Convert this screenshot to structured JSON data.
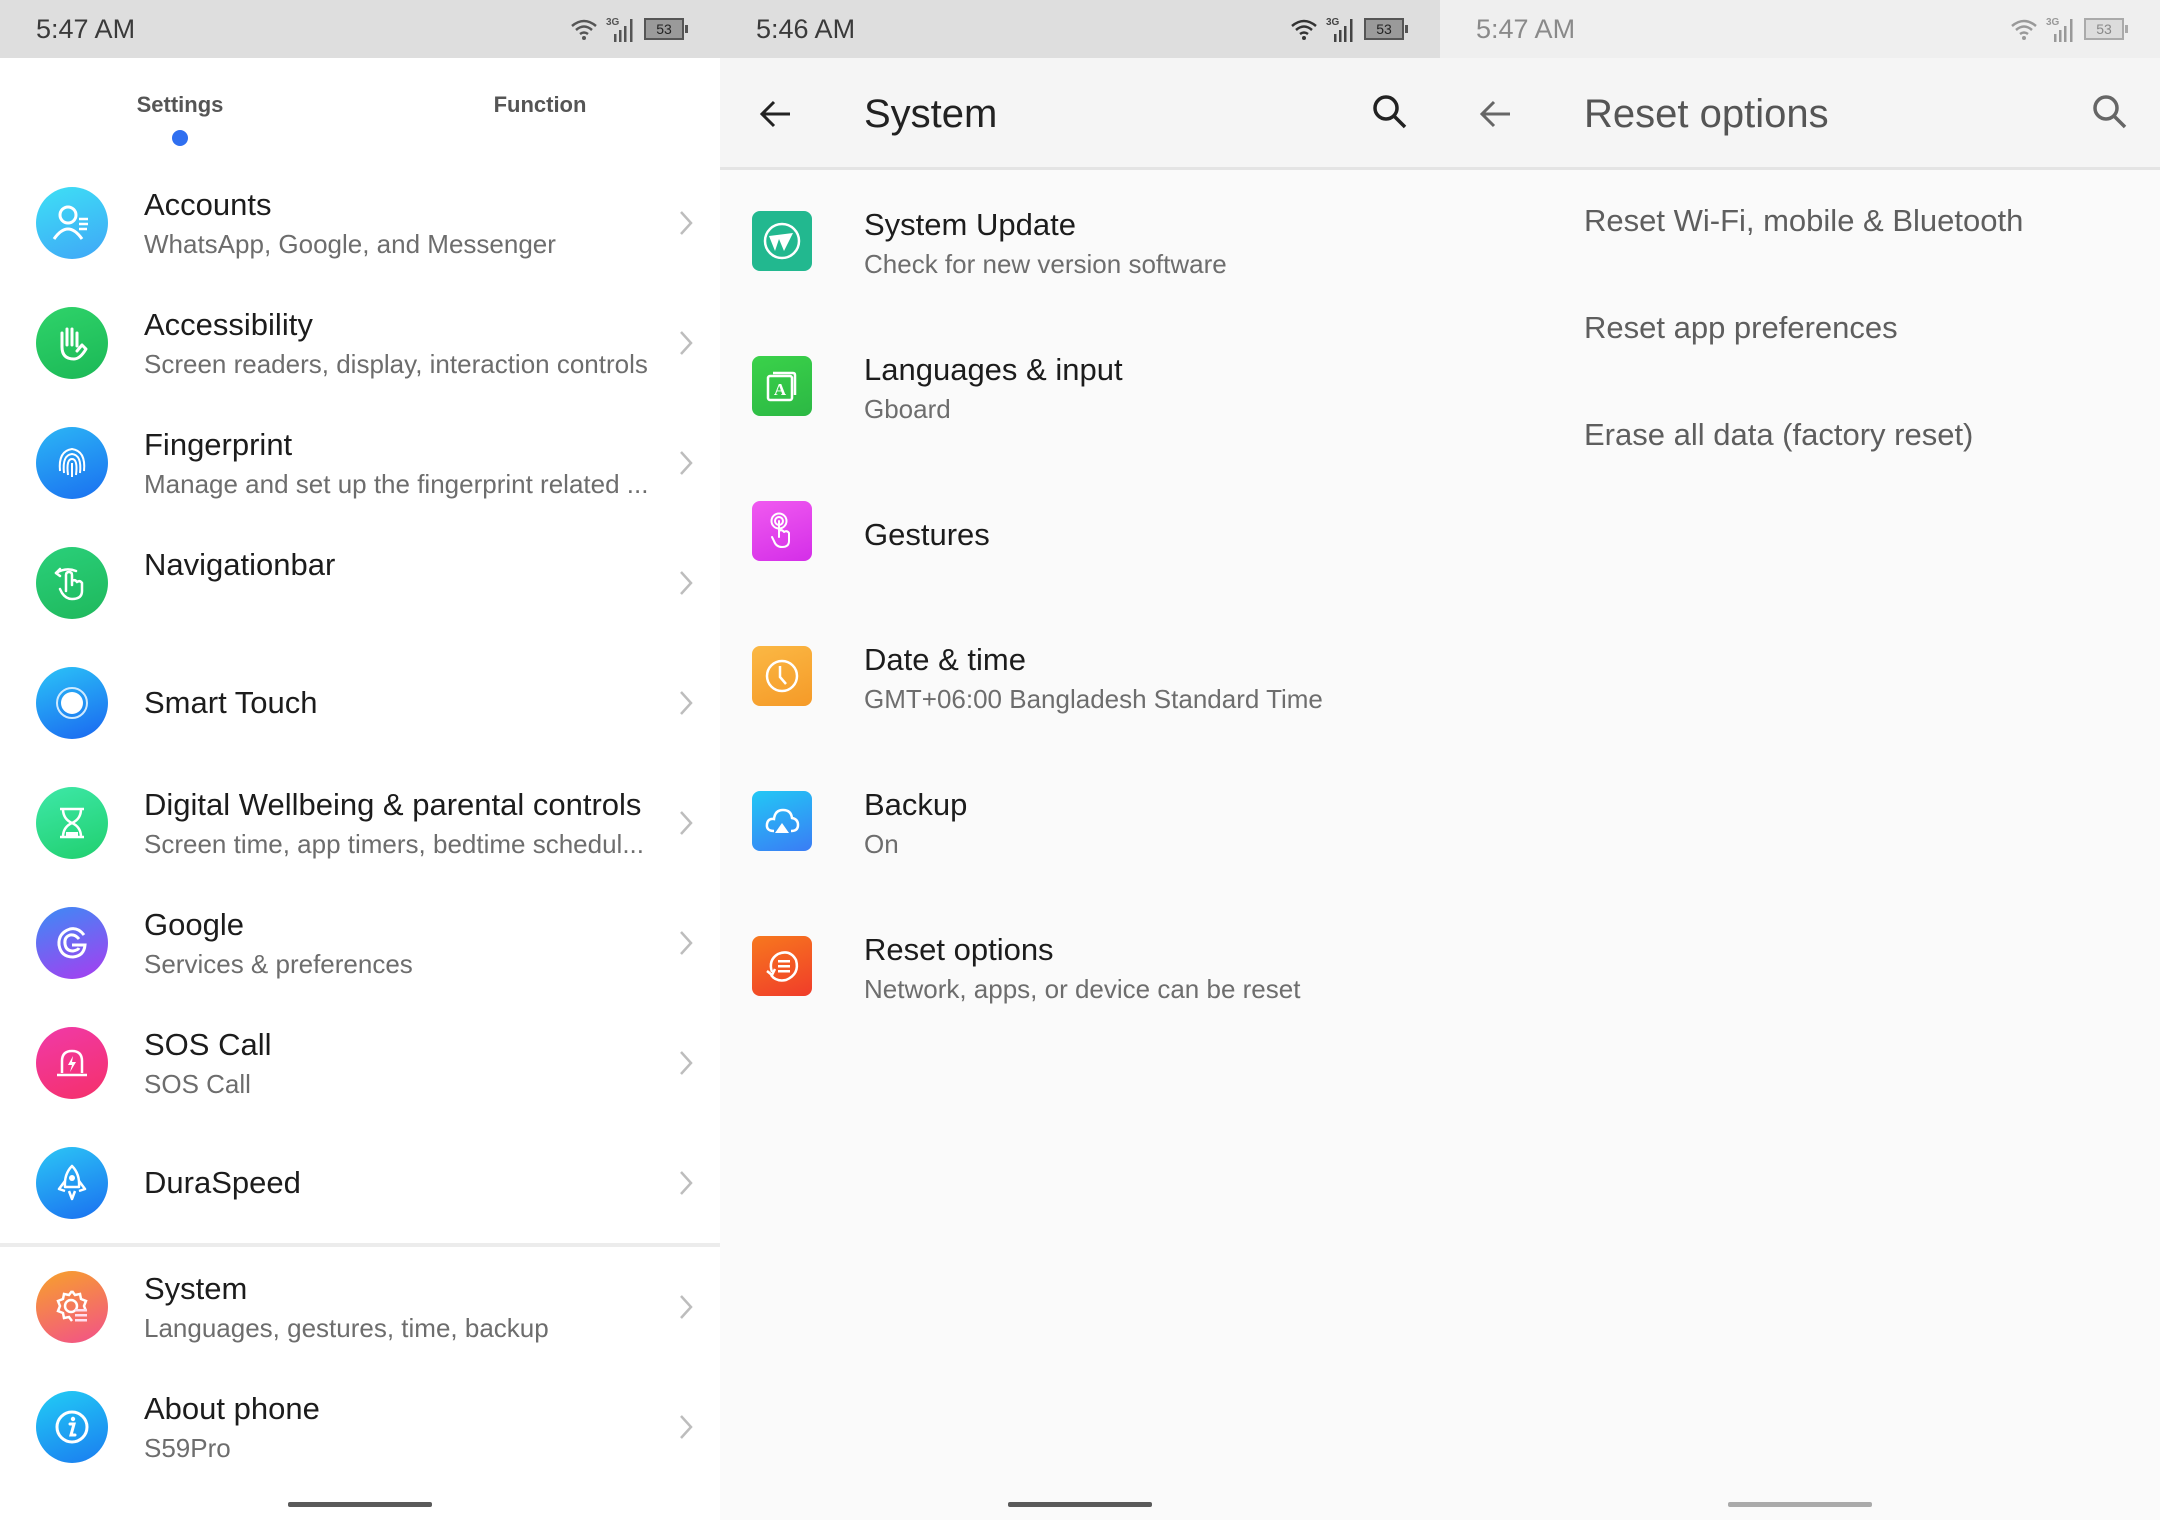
{
  "panel1": {
    "status": {
      "time": "5:47 AM",
      "network": "3G",
      "battery": "53"
    },
    "tabs": [
      {
        "label": "Settings",
        "active": true
      },
      {
        "label": "Function",
        "active": false
      }
    ],
    "items": [
      {
        "title": "Accounts",
        "subtitle": "WhatsApp, Google, and Messenger",
        "icon": "account-icon",
        "color": "#3fc6f5"
      },
      {
        "title": "Accessibility",
        "subtitle": "Screen readers, display, interaction controls",
        "icon": "hand-icon",
        "color": "#22c55e"
      },
      {
        "title": "Fingerprint",
        "subtitle": "Manage and set up the fingerprint related ...",
        "icon": "fingerprint-icon",
        "color": "#1e88f0"
      },
      {
        "title": "Navigationbar",
        "subtitle": "",
        "icon": "swipe-hand-icon",
        "color": "#23c26a"
      },
      {
        "title": "Smart Touch",
        "subtitle": "",
        "icon": "smart-touch-icon",
        "color": "#1e7cf2"
      },
      {
        "title": "Digital Wellbeing & parental controls",
        "subtitle": "Screen time, app timers, bedtime schedul...",
        "icon": "hourglass-icon",
        "color": "#2ed88a"
      },
      {
        "title": "Google",
        "subtitle": "Services & preferences",
        "icon": "google-icon",
        "color": "#7b4cf0"
      },
      {
        "title": "SOS Call",
        "subtitle": "SOS Call",
        "icon": "sos-alarm-icon",
        "color": "#f0307a"
      },
      {
        "title": "DuraSpeed",
        "subtitle": "",
        "icon": "rocket-icon",
        "color": "#1e8cf0"
      },
      {
        "title": "System",
        "subtitle": "Languages, gestures, time, backup",
        "icon": "system-gear-icon",
        "color": "#f57a3a"
      },
      {
        "title": "About phone",
        "subtitle": "S59Pro",
        "icon": "info-icon",
        "color": "#1e9cf0"
      }
    ]
  },
  "panel2": {
    "status": {
      "time": "5:46 AM",
      "network": "3G",
      "battery": "53"
    },
    "title": "System",
    "items": [
      {
        "title": "System Update",
        "subtitle": "Check for new version software",
        "icon": "system-update-icon",
        "color": "#22b88f"
      },
      {
        "title": "Languages & input",
        "subtitle": "Gboard",
        "icon": "language-icon",
        "color": "#35c44a"
      },
      {
        "title": "Gestures",
        "subtitle": "",
        "icon": "gesture-icon",
        "color": "#e040f0"
      },
      {
        "title": "Date & time",
        "subtitle": "GMT+06:00 Bangladesh Standard Time",
        "icon": "clock-icon",
        "color": "#f7a030"
      },
      {
        "title": "Backup",
        "subtitle": "On",
        "icon": "cloud-backup-icon",
        "color": "#2aa8f5"
      },
      {
        "title": "Reset options",
        "subtitle": "Network, apps, or device can be reset",
        "icon": "reset-icon",
        "color": "#f05a28"
      }
    ]
  },
  "panel3": {
    "status": {
      "time": "5:47 AM",
      "network": "3G",
      "battery": "53"
    },
    "title": "Reset options",
    "items": [
      {
        "title": "Reset Wi-Fi, mobile & Bluetooth"
      },
      {
        "title": "Reset app preferences"
      },
      {
        "title": "Erase all data (factory reset)"
      }
    ]
  }
}
